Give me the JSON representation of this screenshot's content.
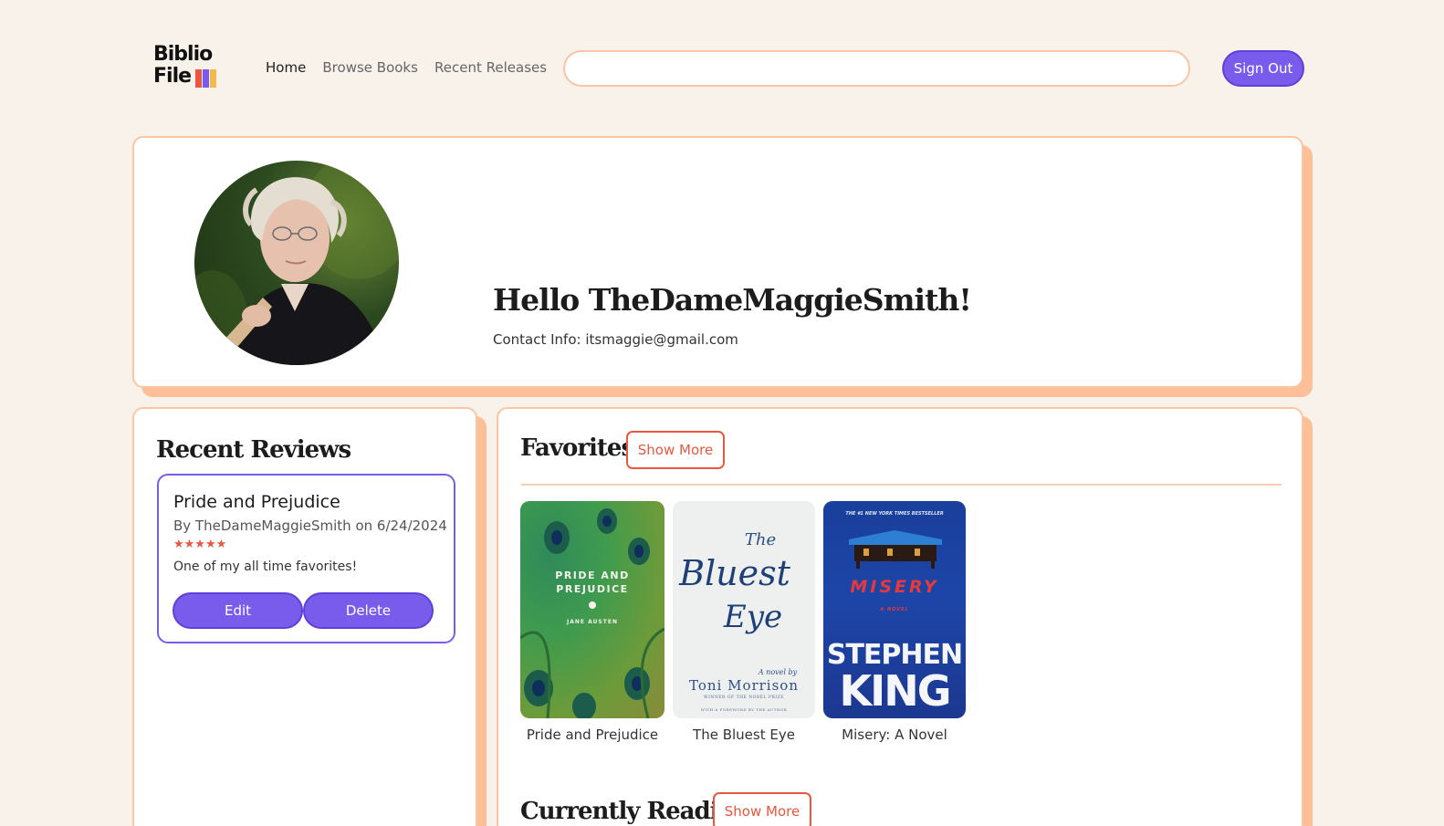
{
  "navbar": {
    "logo_line1": "Biblio",
    "logo_line2": "File",
    "logo_colors": [
      "#e9573f",
      "#7a5cec",
      "#f5b94b"
    ],
    "links": [
      {
        "label": "Home",
        "active": true
      },
      {
        "label": "Browse Books",
        "active": false
      },
      {
        "label": "Recent Releases",
        "active": false
      }
    ],
    "search_value": "",
    "signout_label": "Sign Out"
  },
  "profile": {
    "greeting": "Hello TheDameMaggieSmith!",
    "contact": "Contact Info: itsmaggie@gmail.com"
  },
  "reviews": {
    "title": "Recent Reviews",
    "items": [
      {
        "book": "Pride and Prejudice",
        "meta": "By TheDameMaggieSmith on 6/24/2024",
        "rating": 5,
        "stars": "★★★★★",
        "text": "One of my all time favorites!",
        "edit_label": "Edit",
        "delete_label": "Delete"
      }
    ]
  },
  "favorites": {
    "title": "Favorites",
    "show_more_label": "Show More",
    "books": [
      {
        "title": "Pride and Prejudice",
        "cover_text": [
          "PRIDE AND",
          "PREJUDICE",
          "JANE AUSTEN"
        ]
      },
      {
        "title": "The Bluest Eye",
        "cover_text": [
          "The",
          "Bluest",
          "Eye",
          "A novel by",
          "Toni Morrison",
          "WINNER OF THE NOBEL PRIZE",
          "WITH A FOREWORD BY THE AUTHOR"
        ]
      },
      {
        "title": "Misery: A Novel",
        "cover_text": [
          "THE #1 NEW YORK TIMES BESTSELLER",
          "MISERY",
          "A NOVEL",
          "STEPHEN",
          "KING"
        ]
      }
    ]
  },
  "currently_reading": {
    "title": "Currently Reading",
    "show_more_label": "Show More"
  },
  "colors": {
    "accent_purple": "#7a5cec",
    "accent_orange": "#e9573f",
    "card_shadow": "#fdbf98",
    "background": "#f8f2eb"
  }
}
